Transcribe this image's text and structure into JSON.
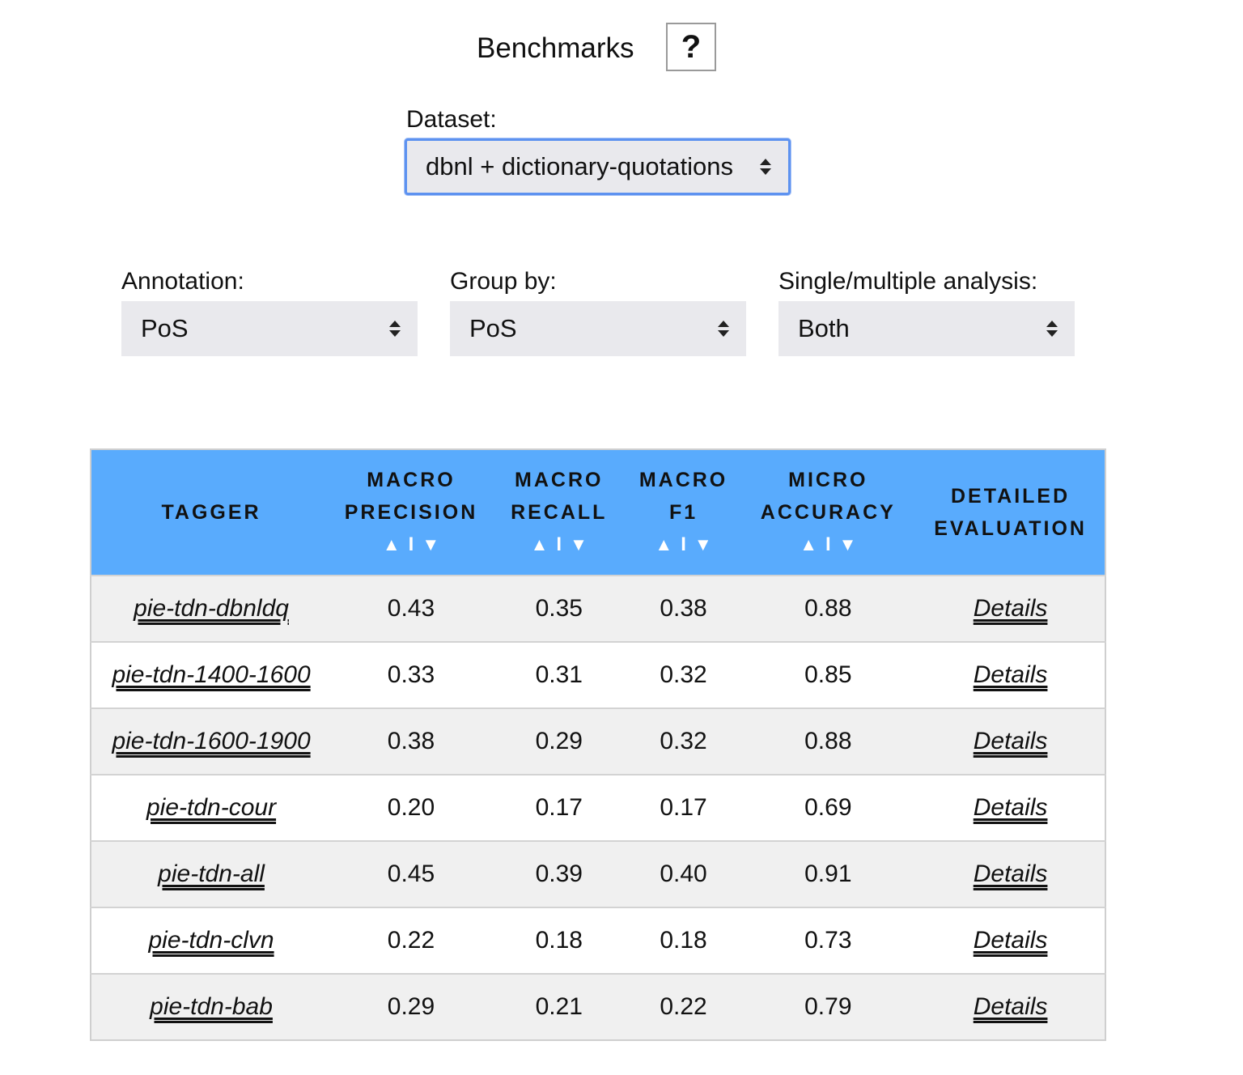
{
  "header": {
    "title": "Benchmarks",
    "help_label": "?"
  },
  "dataset": {
    "label": "Dataset:",
    "selected": "dbnl + dictionary-quotations"
  },
  "filters": [
    {
      "label": "Annotation:",
      "selected": "PoS"
    },
    {
      "label": "Group by:",
      "selected": "PoS"
    },
    {
      "label": "Single/multiple analysis:",
      "selected": "Both"
    }
  ],
  "table": {
    "columns": {
      "tagger": "TAGGER",
      "macro_precision": [
        "MACRO",
        "PRECISION"
      ],
      "macro_recall": [
        "MACRO",
        "RECALL"
      ],
      "macro_f1": [
        "MACRO",
        "F1"
      ],
      "micro_accuracy": [
        "MICRO",
        "ACCURACY"
      ],
      "detailed": [
        "DETAILED",
        "EVALUATION"
      ]
    },
    "sort": {
      "asc": "▲",
      "sep": "I",
      "desc": "▼"
    },
    "rows": [
      {
        "tagger": "pie-tdn-dbnldq",
        "precision": "0.43",
        "recall": "0.35",
        "f1": "0.38",
        "accuracy": "0.88",
        "details": "Details"
      },
      {
        "tagger": "pie-tdn-1400-1600",
        "precision": "0.33",
        "recall": "0.31",
        "f1": "0.32",
        "accuracy": "0.85",
        "details": "Details"
      },
      {
        "tagger": "pie-tdn-1600-1900",
        "precision": "0.38",
        "recall": "0.29",
        "f1": "0.32",
        "accuracy": "0.88",
        "details": "Details"
      },
      {
        "tagger": "pie-tdn-cour",
        "precision": "0.20",
        "recall": "0.17",
        "f1": "0.17",
        "accuracy": "0.69",
        "details": "Details"
      },
      {
        "tagger": "pie-tdn-all",
        "precision": "0.45",
        "recall": "0.39",
        "f1": "0.40",
        "accuracy": "0.91",
        "details": "Details"
      },
      {
        "tagger": "pie-tdn-clvn",
        "precision": "0.22",
        "recall": "0.18",
        "f1": "0.18",
        "accuracy": "0.73",
        "details": "Details"
      },
      {
        "tagger": "pie-tdn-bab",
        "precision": "0.29",
        "recall": "0.21",
        "f1": "0.22",
        "accuracy": "0.79",
        "details": "Details"
      }
    ]
  },
  "colors": {
    "header_bg": "#59abfd",
    "focus_border": "#5d92f0",
    "select_bg": "#e9e9ed",
    "row_alt": "#f0f0f0"
  }
}
